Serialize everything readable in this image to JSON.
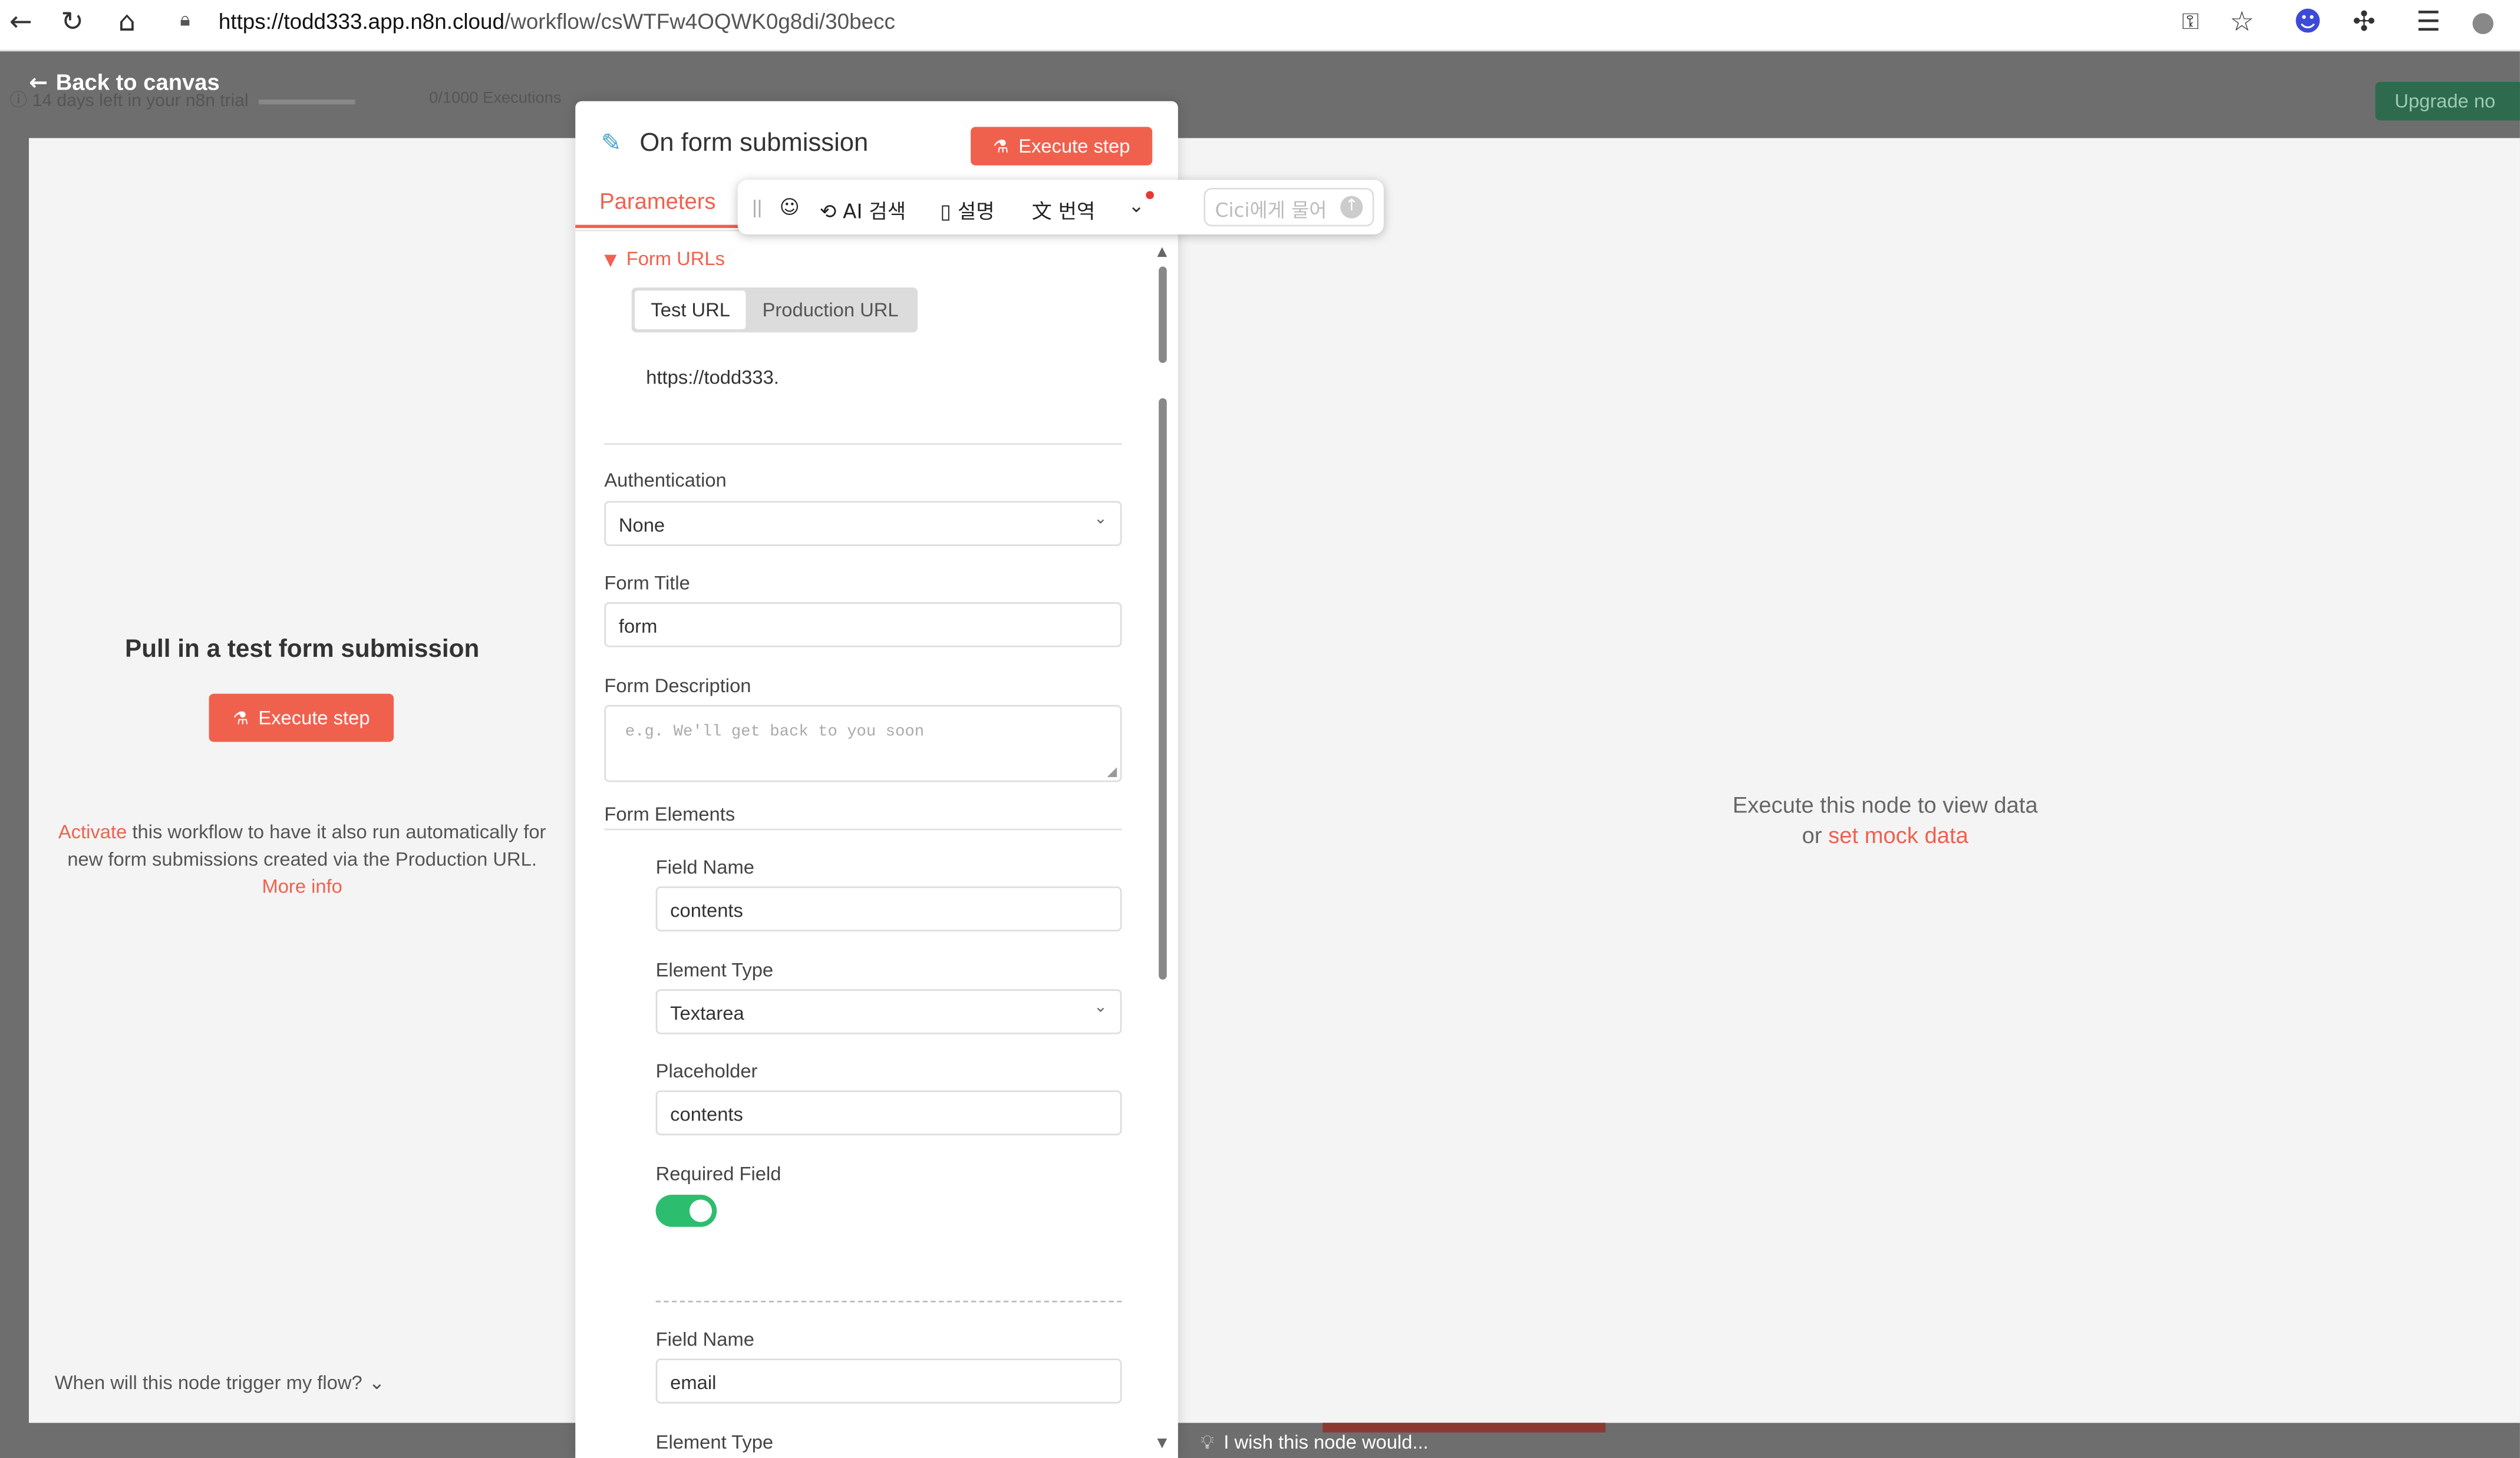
{
  "browser": {
    "url_host": "https://todd333.app.n8n.cloud",
    "url_path": "/workflow/csWTFw4OQWK0g8di/30becc"
  },
  "app": {
    "trial_text": "14 days left in your n8n trial",
    "executions_text": "0/1000 Executions",
    "upgrade_label": "Upgrade no",
    "back_label": "Back to canvas"
  },
  "input_pane": {
    "title": "Pull in a test form submission",
    "execute_label": "Execute step",
    "activate_link": "Activate",
    "activate_text": " this workflow to have it also run automatically for new form submissions created via the Production URL. ",
    "more_info": "More info",
    "when_label": "When will this node trigger my flow?"
  },
  "node": {
    "title": "On form submission",
    "execute_label": "Execute step",
    "tab_parameters": "Parameters",
    "form_urls_label": "Form URLs",
    "url_tabs": [
      "Test URL",
      "Production URL"
    ],
    "url_value": "https://todd333.",
    "authentication": {
      "label": "Authentication",
      "value": "None"
    },
    "form_title": {
      "label": "Form Title",
      "value": "form"
    },
    "form_description": {
      "label": "Form Description",
      "placeholder": "e.g. We'll get back to you soon"
    },
    "form_elements_label": "Form Elements",
    "element1": {
      "field_name_label": "Field Name",
      "field_name": "contents",
      "element_type_label": "Element Type",
      "element_type": "Textarea",
      "placeholder_label": "Placeholder",
      "placeholder": "contents",
      "required_label": "Required Field",
      "required": true
    },
    "element2": {
      "field_name_label": "Field Name",
      "field_name": "email",
      "element_type_label": "Element Type"
    }
  },
  "ai_toolbar": {
    "grip": "||",
    "ai_search": "AI 검색",
    "explain": "설명",
    "translate": "번역",
    "ask_placeholder": "Cici에게 물어"
  },
  "output_pane": {
    "message": "Execute this node to view data",
    "or_text": "or ",
    "mock_link": "set mock data"
  },
  "footer": {
    "wish_label": "I wish this node would..."
  }
}
